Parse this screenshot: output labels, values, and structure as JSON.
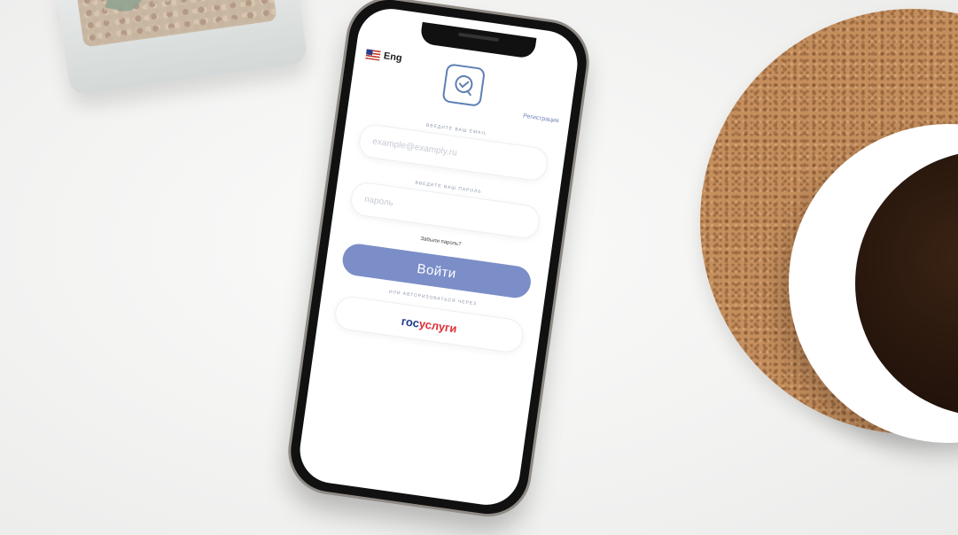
{
  "app": {
    "language": {
      "label": "Eng",
      "flag": "us-flag-icon"
    },
    "logo": "checkmark-chat-icon",
    "register_link": "Регистрация"
  },
  "login": {
    "email_caption": "ВВЕДИТЕ ВАШ EMAIL",
    "email_placeholder": "example@examply.ru",
    "password_caption": "ВВЕДИТЕ ВАШ ПАРОЛЬ",
    "password_placeholder": "пароль",
    "forgot_link": "Забыли пароль?",
    "submit_label": "Войти",
    "alt_caption": "ИЛИ АВТОРИЗОВАТЬСЯ ЧЕРЕЗ",
    "gosuslugi": {
      "part1": "гос",
      "part2": "услуги"
    }
  },
  "colors": {
    "accent": "#7b8ec8",
    "logo_blue": "#5d7fb3",
    "gos_blue": "#1e3b8c",
    "gos_red": "#e0303a"
  }
}
